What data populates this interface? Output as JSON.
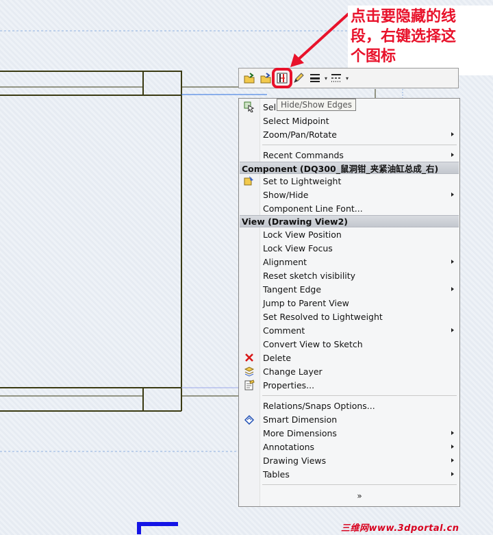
{
  "annotation": {
    "line1": "点击要隐藏的线",
    "line2": "段，右键选择这",
    "line3": "个图标"
  },
  "toolbar": {
    "buttons": [
      {
        "name": "open-folder-icon"
      },
      {
        "name": "open-folder-2-icon"
      },
      {
        "name": "hide-show-edges-icon"
      },
      {
        "name": "pencil-icon"
      },
      {
        "name": "line-thickness-icon"
      },
      {
        "name": "line-style-icon"
      }
    ]
  },
  "tooltip": "Hide/Show Edges",
  "menu": {
    "select": "Sel",
    "select_midpoint": "Select Midpoint",
    "zoom_pan_rotate": "Zoom/Pan/Rotate",
    "recent_commands": "Recent Commands",
    "component_header": "Component (DQ300_鼠洞钳_夹紧油缸总成_右)",
    "set_to_lightweight": "Set to Lightweight",
    "show_hide": "Show/Hide",
    "component_line_font": "Component Line Font...",
    "view_header": "View (Drawing View2)",
    "lock_view_position": "Lock View Position",
    "lock_view_focus": "Lock View Focus",
    "alignment": "Alignment",
    "reset_sketch_visibility": "Reset sketch visibility",
    "tangent_edge": "Tangent Edge",
    "jump_to_parent_view": "Jump to Parent View",
    "set_resolved_to_lightweight": "Set Resolved to Lightweight",
    "comment": "Comment",
    "convert_view_to_sketch": "Convert View to Sketch",
    "delete": "Delete",
    "change_layer": "Change Layer",
    "properties": "Properties...",
    "relations_snaps": "Relations/Snaps Options...",
    "smart_dimension": "Smart Dimension",
    "more_dimensions": "More Dimensions",
    "annotations": "Annotations",
    "drawing_views": "Drawing Views",
    "tables": "Tables",
    "expand": "»"
  },
  "watermark": "三维网www.3dportal.cn",
  "colors": {
    "accent_red": "#e8122b",
    "drawing_line": "#3a3a12",
    "selection_blue": "#2a6fe0",
    "blue_block": "#1414e6"
  }
}
